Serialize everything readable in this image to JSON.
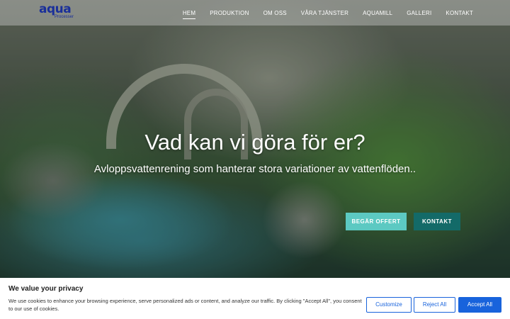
{
  "logo": {
    "text": "aqua",
    "sub": "Processer"
  },
  "nav": {
    "items": [
      {
        "label": "Hem",
        "active": true
      },
      {
        "label": "Produktion",
        "active": false
      },
      {
        "label": "Om oss",
        "active": false
      },
      {
        "label": "Våra tjänster",
        "active": false
      },
      {
        "label": "Aquamill",
        "active": false
      },
      {
        "label": "Galleri",
        "active": false
      },
      {
        "label": "Kontakt",
        "active": false
      }
    ]
  },
  "hero": {
    "title": "Vad kan vi göra för er?",
    "subtitle": "Avloppsvattenrening som hanterar stora variationer av vattenflöden..",
    "button_offert": "BEGÄR OFFERT",
    "button_kontakt": "KONTAKT"
  },
  "cookie": {
    "title": "We value your privacy",
    "text": "We use cookies to enhance your browsing experience, serve personalized ads or content, and analyze our traffic. By clicking \"Accept All\", you consent to our use of cookies.",
    "customize": "Customize",
    "reject": "Reject All",
    "accept": "Accept All"
  },
  "colors": {
    "accent": "#5cc9c2",
    "dark_accent": "#136a68",
    "cookie_blue": "#1863dc",
    "logo_blue": "#1a2f9a"
  }
}
